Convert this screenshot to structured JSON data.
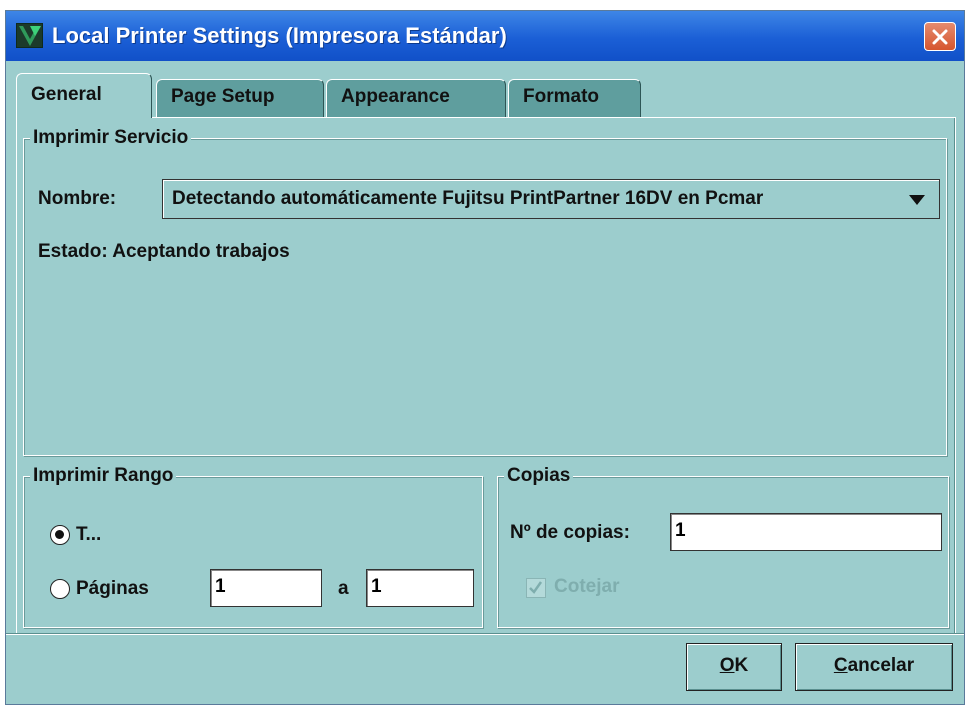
{
  "window": {
    "title": "Local Printer Settings (Impresora Estándar)",
    "app_icon": "app-logo-icon",
    "close_icon": "close-icon"
  },
  "tabs": [
    {
      "label": "General",
      "active": true
    },
    {
      "label": "Page Setup",
      "active": false
    },
    {
      "label": "Appearance",
      "active": false
    },
    {
      "label": "Formato",
      "active": false
    }
  ],
  "print_service": {
    "legend": "Imprimir Servicio",
    "name_label": "Nombre:",
    "name_value": "Detectando automáticamente Fujitsu PrintPartner 16DV en Pcmar",
    "status_label": "Estado:",
    "status_value": "Aceptando trabajos"
  },
  "print_range": {
    "legend": "Imprimir Rango",
    "all_label": "T...",
    "all_selected": true,
    "pages_label": "Páginas",
    "from_value": "1",
    "to_label": "a",
    "to_value": "1"
  },
  "copies": {
    "legend": "Copias",
    "count_label": "Nº de copias:",
    "count_value": "1",
    "collate_label": "Cotejar",
    "collate_checked": true,
    "collate_enabled": false
  },
  "buttons": {
    "ok_mnemonic": "O",
    "ok_rest": "K",
    "cancel_mnemonic": "C",
    "cancel_rest": "ancelar"
  },
  "colors": {
    "background": "#9ccdcd",
    "titlebar": "#1b5fd6",
    "inactive_tab": "#5f9e9e"
  }
}
